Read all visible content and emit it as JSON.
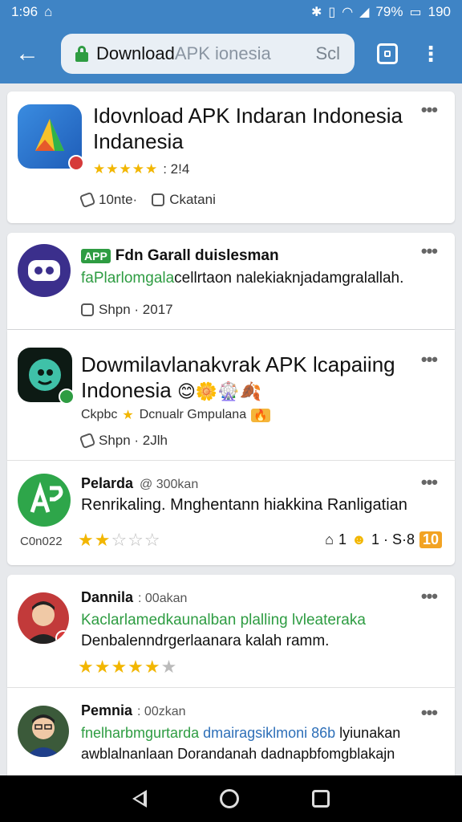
{
  "status": {
    "time": "1:96",
    "left_icon": "notification-icon",
    "battery": "79%",
    "right_time": "190"
  },
  "toolbar": {
    "address_title": "Download",
    "address_faded": " APK ionesia",
    "address_tail": "Scl"
  },
  "card1": {
    "title": "Idovnload APK Indaran Indonesia Indanesia",
    "rating_text": ": 2!4",
    "size": "10nte·",
    "category": "Ckatani"
  },
  "card2": {
    "tag": "APP",
    "title": "Fdn Garall duislesman",
    "subtitle_green": "faPlarlomgala",
    "subtitle_rest": "cellrtaon nalekiaknjadamgralallah.",
    "meta": "Shpn · 2017"
  },
  "card3": {
    "title": "Dowmilavlanakvrak APK lcapaiing Indonesia",
    "sub_a": "Ckpbc",
    "sub_b": "Dcnualr Gmpulana",
    "meta": "Shpn · 2Jlh"
  },
  "review1": {
    "name": "Pelarda",
    "time": "@ 300kan",
    "text": "Renrikaling. Mnghentann hiakkina Ranligatian",
    "left_label": "C0n022",
    "right_text_a": "1",
    "right_text_b": "1 · S·8",
    "right_badge": "10"
  },
  "review2": {
    "name": "Dannila",
    "time": ": 00akan",
    "text_green": "Kaclarlamedkaunalban plalling lvleateraka",
    "text": "Denbalenndrgerlaanara kalah ramm."
  },
  "review3": {
    "name": "Pemnia",
    "time": ": 00zkan",
    "text_green": "fnelharbmgurtarda",
    "text_blue": " dmairagsiklmoni 86b",
    "text_rest": " lyiunakan",
    "text2": "awblalnanlaan Dorandanah dadnapbfomgblakajn"
  },
  "colors": {
    "primary": "#3f84c5",
    "green": "#2e9c42",
    "star": "#f2b600"
  }
}
